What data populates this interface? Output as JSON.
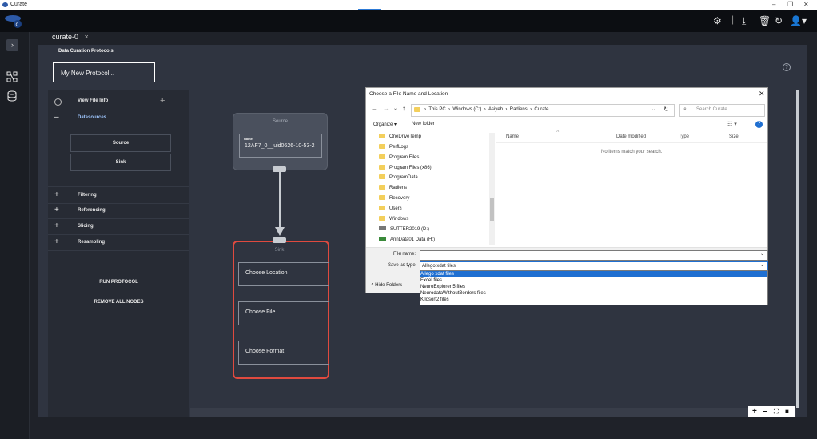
{
  "window": {
    "title": "Curate"
  },
  "tab": {
    "label": "curate-0",
    "close": "×"
  },
  "protocol": {
    "section_label": "Data Curation Protocols",
    "name": "My New Protocol..."
  },
  "left_panel": {
    "view_file_info": "View File Info",
    "datasources": "Datasources",
    "source_btn": "Source",
    "sink_btn": "Sink",
    "filtering": "Filtering",
    "referencing": "Referencing",
    "slicing": "Slicing",
    "resampling": "Resampling",
    "run_protocol": "RUN PROTOCOL",
    "remove_all": "REMOVE ALL NODES"
  },
  "canvas": {
    "source_node": {
      "title": "Source",
      "name_label": "Name",
      "name_value": "12AF7_0__uid0626-10-53-2"
    },
    "sink_node": {
      "title": "Sink",
      "choose_location": "Choose Location",
      "choose_file": "Choose File",
      "choose_format": "Choose Format"
    }
  },
  "dialog": {
    "title": "Choose a File Name and Location",
    "breadcrumb": [
      "This PC",
      "Windows (C:)",
      "Asiyeh",
      "Radiens",
      "Curate"
    ],
    "search_placeholder": "Search Curate",
    "organize": "Organize ▾",
    "new_folder": "New folder",
    "tree": [
      "OneDriveTemp",
      "PerfLogs",
      "Program Files",
      "Program Files (x86)",
      "ProgramData",
      "Radiens",
      "Recovery",
      "Users",
      "Windows"
    ],
    "drives": [
      "SUTTER2019 (D:)",
      "AnnData01 Data (H:)"
    ],
    "columns": {
      "name": "Name",
      "date": "Date modified",
      "type": "Type",
      "size": "Size"
    },
    "empty_msg": "No items match your search.",
    "file_name_label": "File name:",
    "file_name_value": "",
    "save_as_label": "Save as type:",
    "save_as_value": "Allego xdat files",
    "options": [
      "Allego xdat files",
      "Excel files",
      "NeuroExplorer 5 files",
      "NeurodataWithoutBorders files",
      "Kilosort2 files"
    ],
    "hide_folders": "Hide Folders"
  },
  "colors": {
    "accent": "#e04a3f",
    "app_bg": "#2f3440",
    "selection": "#2d7ad6"
  }
}
